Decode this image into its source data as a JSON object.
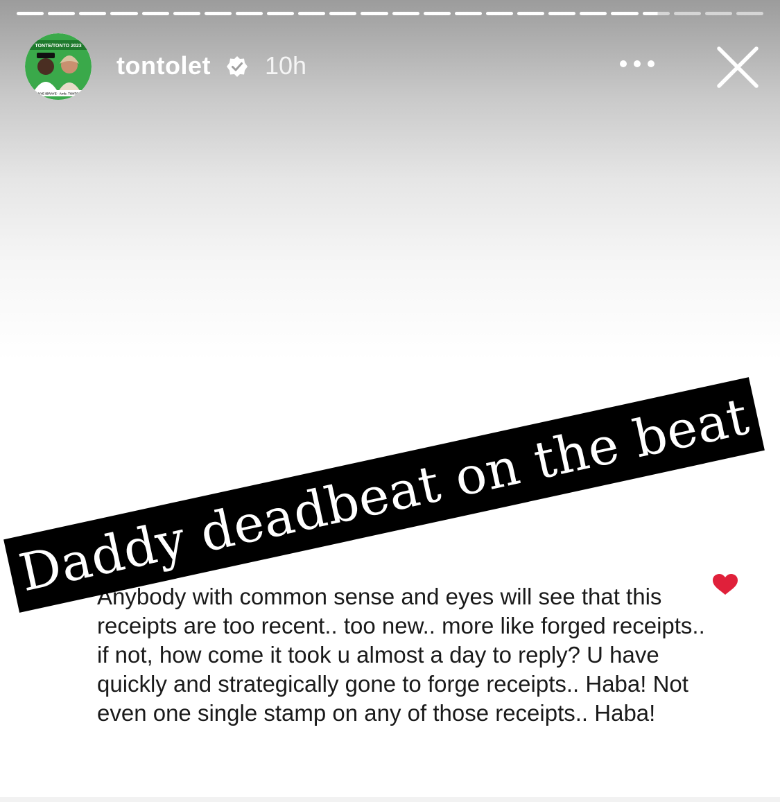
{
  "story": {
    "progress": {
      "total_segments": 24,
      "completed_segments": 20,
      "current_segment_fraction": 0.55
    },
    "account": {
      "username": "tontolet",
      "verified": true,
      "time_ago": "10h",
      "avatar": {
        "banner_text": "TONTE/TONTO 2023",
        "footer_text": "TONYE IBRAYE · Amb. TONTO DI",
        "colors": {
          "background": "#3aa94a",
          "banner": "#1f7a2d"
        }
      }
    },
    "icons": {
      "more": "more-horizontal-icon",
      "close": "close-icon",
      "verified": "verified-badge-icon",
      "heart": "heart-icon"
    },
    "sticker": {
      "text": "Daddy deadbeat on the beat",
      "background": "#000000",
      "color": "#ffffff"
    },
    "comment": {
      "text": "Anybody with common sense and eyes will see that this receipts are too recent.. too new.. more like forged receipts.. if not, how come it took u almost a day to reply? U have quickly and strategically gone to forge receipts.. Haba! Not even one single stamp on any of those receipts.. Haba!",
      "liked": true,
      "heart_color": "#e0203a"
    }
  }
}
